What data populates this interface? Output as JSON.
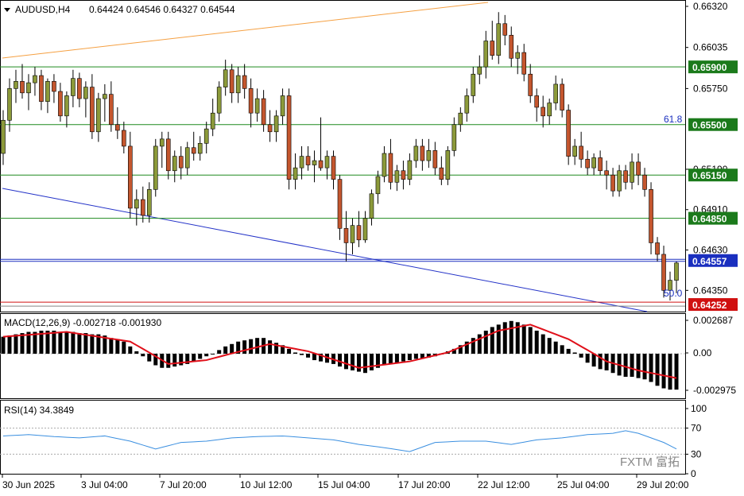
{
  "colors": {
    "bull": "#8c9a3a",
    "bear": "#c4562e",
    "wick": "#000000",
    "level": "#1f8a1f",
    "level_label_bg": "#1b7a1b",
    "current": "#1a2fbf",
    "red_level": "#d01010",
    "macd_signal": "#e0101a",
    "rsi_line": "#3a8fe0",
    "trend_orange": "#f5a042",
    "trend_blue": "#2433c8"
  },
  "header": {
    "symbol": "AUDUSD,H4",
    "ohlc": "0.64424 0.64546 0.64327 0.64544"
  },
  "price_axis": {
    "ticks": [
      "0.66320",
      "0.66035",
      "0.65750",
      "0.65190",
      "0.64910",
      "0.64630",
      "0.64350"
    ],
    "levels": [
      "0.65900",
      "0.65500",
      "0.65150",
      "0.64850"
    ],
    "current": "0.64557",
    "red_level": "0.64252"
  },
  "fib_labels": {
    "upper": "61.8",
    "lower": "50.0"
  },
  "macd": {
    "label": "MACD(12,26,9) -0.002718 -0.001930",
    "ticks": [
      "0.002687",
      "0.00",
      "-0.002975"
    ]
  },
  "rsi": {
    "label": "RSI(14) 34.3849",
    "ticks": [
      "100",
      "70",
      "30",
      "0"
    ]
  },
  "time_axis": [
    "30 Jun 2025",
    "3 Jul 04:00",
    "7 Jul 20:00",
    "10 Jul 12:00",
    "15 Jul 04:00",
    "17 Jul 20:00",
    "22 Jul 12:00",
    "25 Jul 04:00",
    "29 Jul 20:00"
  ],
  "watermark": "FXTM 富拓",
  "chart_data": {
    "type": "candlestick",
    "symbol": "AUDUSD",
    "timeframe": "H4",
    "ylim": [
      0.6419,
      0.6634
    ],
    "candles": [
      [
        0.653,
        0.656,
        0.6522,
        0.6553
      ],
      [
        0.6553,
        0.6582,
        0.6545,
        0.6575
      ],
      [
        0.6575,
        0.6588,
        0.6565,
        0.658
      ],
      [
        0.658,
        0.6592,
        0.6568,
        0.6572
      ],
      [
        0.6572,
        0.6585,
        0.656,
        0.6579
      ],
      [
        0.6579,
        0.659,
        0.657,
        0.6584
      ],
      [
        0.6584,
        0.6588,
        0.656,
        0.6566
      ],
      [
        0.6566,
        0.6582,
        0.6558,
        0.658
      ],
      [
        0.658,
        0.6585,
        0.6565,
        0.6573
      ],
      [
        0.6573,
        0.6579,
        0.6552,
        0.6556
      ],
      [
        0.6556,
        0.6573,
        0.6548,
        0.657
      ],
      [
        0.657,
        0.6588,
        0.6562,
        0.6582
      ],
      [
        0.6582,
        0.6586,
        0.6562,
        0.6568
      ],
      [
        0.6568,
        0.658,
        0.6555,
        0.6576
      ],
      [
        0.6576,
        0.6585,
        0.654,
        0.6545
      ],
      [
        0.6545,
        0.6572,
        0.6538,
        0.6568
      ],
      [
        0.6568,
        0.6578,
        0.6552,
        0.6571
      ],
      [
        0.6571,
        0.658,
        0.6545,
        0.655
      ],
      [
        0.655,
        0.6562,
        0.654,
        0.6546
      ],
      [
        0.6546,
        0.6552,
        0.653,
        0.6535
      ],
      [
        0.6535,
        0.6545,
        0.6485,
        0.6492
      ],
      [
        0.6492,
        0.6505,
        0.648,
        0.6498
      ],
      [
        0.6498,
        0.6507,
        0.6482,
        0.6487
      ],
      [
        0.6487,
        0.651,
        0.6482,
        0.6505
      ],
      [
        0.6505,
        0.654,
        0.65,
        0.6535
      ],
      [
        0.6535,
        0.6545,
        0.652,
        0.654
      ],
      [
        0.654,
        0.6545,
        0.6512,
        0.6518
      ],
      [
        0.6518,
        0.6532,
        0.651,
        0.6528
      ],
      [
        0.6528,
        0.6535,
        0.6512,
        0.652
      ],
      [
        0.652,
        0.6538,
        0.6515,
        0.6534
      ],
      [
        0.6534,
        0.6545,
        0.6525,
        0.653
      ],
      [
        0.653,
        0.6542,
        0.6525,
        0.6537
      ],
      [
        0.6537,
        0.6552,
        0.653,
        0.6547
      ],
      [
        0.6547,
        0.6568,
        0.6542,
        0.6558
      ],
      [
        0.6558,
        0.658,
        0.6552,
        0.6576
      ],
      [
        0.6576,
        0.6595,
        0.657,
        0.6588
      ],
      [
        0.6588,
        0.6592,
        0.6565,
        0.6572
      ],
      [
        0.6572,
        0.659,
        0.6565,
        0.6584
      ],
      [
        0.6584,
        0.6592,
        0.6568,
        0.6575
      ],
      [
        0.6575,
        0.6582,
        0.6548,
        0.6558
      ],
      [
        0.6558,
        0.6575,
        0.6552,
        0.6568
      ],
      [
        0.6568,
        0.6574,
        0.6545,
        0.655
      ],
      [
        0.655,
        0.656,
        0.6538,
        0.6545
      ],
      [
        0.6545,
        0.656,
        0.6538,
        0.6556
      ],
      [
        0.6556,
        0.6575,
        0.655,
        0.657
      ],
      [
        0.657,
        0.6575,
        0.6505,
        0.6512
      ],
      [
        0.6512,
        0.653,
        0.6505,
        0.652
      ],
      [
        0.652,
        0.6535,
        0.6512,
        0.6528
      ],
      [
        0.6528,
        0.6535,
        0.6518,
        0.6522
      ],
      [
        0.6522,
        0.6532,
        0.651,
        0.6525
      ],
      [
        0.6525,
        0.6555,
        0.6518,
        0.652
      ],
      [
        0.652,
        0.6532,
        0.6512,
        0.6528
      ],
      [
        0.6528,
        0.6532,
        0.6505,
        0.6512
      ],
      [
        0.6512,
        0.6515,
        0.647,
        0.6478
      ],
      [
        0.6478,
        0.649,
        0.6455,
        0.6468
      ],
      [
        0.6468,
        0.6485,
        0.646,
        0.648
      ],
      [
        0.648,
        0.649,
        0.6465,
        0.647
      ],
      [
        0.647,
        0.649,
        0.6468,
        0.6485
      ],
      [
        0.6485,
        0.6505,
        0.648,
        0.6502
      ],
      [
        0.6502,
        0.6518,
        0.6495,
        0.6514
      ],
      [
        0.6514,
        0.6535,
        0.651,
        0.653
      ],
      [
        0.653,
        0.654,
        0.6505,
        0.651
      ],
      [
        0.651,
        0.6522,
        0.6504,
        0.6518
      ],
      [
        0.6518,
        0.6525,
        0.6505,
        0.6512
      ],
      [
        0.6512,
        0.653,
        0.6508,
        0.6525
      ],
      [
        0.6525,
        0.654,
        0.652,
        0.6535
      ],
      [
        0.6535,
        0.654,
        0.6518,
        0.6525
      ],
      [
        0.6525,
        0.654,
        0.652,
        0.6532
      ],
      [
        0.6532,
        0.6538,
        0.6515,
        0.652
      ],
      [
        0.652,
        0.6528,
        0.6508,
        0.6512
      ],
      [
        0.6512,
        0.6535,
        0.6508,
        0.6532
      ],
      [
        0.6532,
        0.6555,
        0.6528,
        0.655
      ],
      [
        0.655,
        0.6562,
        0.6545,
        0.6558
      ],
      [
        0.6558,
        0.6575,
        0.6552,
        0.657
      ],
      [
        0.657,
        0.659,
        0.6565,
        0.6585
      ],
      [
        0.6585,
        0.6598,
        0.6578,
        0.659
      ],
      [
        0.659,
        0.6615,
        0.6582,
        0.6608
      ],
      [
        0.6608,
        0.6622,
        0.6595,
        0.6598
      ],
      [
        0.6598,
        0.6628,
        0.6592,
        0.662
      ],
      [
        0.662,
        0.6626,
        0.6605,
        0.6612
      ],
      [
        0.6612,
        0.6618,
        0.659,
        0.6596
      ],
      [
        0.6596,
        0.6605,
        0.6585,
        0.66
      ],
      [
        0.66,
        0.6606,
        0.658,
        0.6585
      ],
      [
        0.6585,
        0.6592,
        0.6565,
        0.657
      ],
      [
        0.657,
        0.6575,
        0.6552,
        0.6562
      ],
      [
        0.6562,
        0.657,
        0.6548,
        0.6556
      ],
      [
        0.6556,
        0.6568,
        0.655,
        0.6565
      ],
      [
        0.6565,
        0.6584,
        0.656,
        0.6578
      ],
      [
        0.6578,
        0.6582,
        0.6555,
        0.656
      ],
      [
        0.656,
        0.6564,
        0.6522,
        0.6528
      ],
      [
        0.6528,
        0.654,
        0.6522,
        0.6535
      ],
      [
        0.6535,
        0.6545,
        0.652,
        0.6526
      ],
      [
        0.6526,
        0.6532,
        0.6515,
        0.652
      ],
      [
        0.652,
        0.653,
        0.6515,
        0.6527
      ],
      [
        0.6527,
        0.6532,
        0.6515,
        0.6518
      ],
      [
        0.6518,
        0.6525,
        0.6505,
        0.6515
      ],
      [
        0.6515,
        0.652,
        0.65,
        0.6504
      ],
      [
        0.6504,
        0.6522,
        0.65,
        0.6518
      ],
      [
        0.6518,
        0.6522,
        0.6505,
        0.651
      ],
      [
        0.651,
        0.653,
        0.6505,
        0.6524
      ],
      [
        0.6524,
        0.653,
        0.6508,
        0.6515
      ],
      [
        0.6515,
        0.652,
        0.65,
        0.6505
      ],
      [
        0.6505,
        0.651,
        0.646,
        0.6468
      ],
      [
        0.6468,
        0.6472,
        0.6455,
        0.646
      ],
      [
        0.646,
        0.6466,
        0.643,
        0.6435
      ],
      [
        0.6435,
        0.6448,
        0.6428,
        0.6442
      ],
      [
        0.6442,
        0.6455,
        0.6433,
        0.6454
      ]
    ],
    "macd_histogram": [
      0.0014,
      0.0015,
      0.0016,
      0.0017,
      0.0018,
      0.0018,
      0.0019,
      0.0019,
      0.0019,
      0.0018,
      0.0018,
      0.0018,
      0.0017,
      0.0017,
      0.0016,
      0.0016,
      0.0015,
      0.0013,
      0.0012,
      0.001,
      0.0006,
      0.0002,
      -0.0002,
      -0.0006,
      -0.0009,
      -0.0011,
      -0.0011,
      -0.001,
      -0.0009,
      -0.0008,
      -0.0006,
      -0.0004,
      -0.0002,
      0.0,
      0.0003,
      0.0006,
      0.0008,
      0.001,
      0.0011,
      0.0012,
      0.0013,
      0.0013,
      0.0011,
      0.0009,
      0.0007,
      0.0004,
      0.0001,
      -0.0001,
      -0.0003,
      -0.0005,
      -0.0006,
      -0.0007,
      -0.0008,
      -0.001,
      -0.0012,
      -0.0013,
      -0.0014,
      -0.0015,
      -0.0013,
      -0.0011,
      -0.0009,
      -0.0008,
      -0.0007,
      -0.0006,
      -0.0005,
      -0.0004,
      -0.0004,
      -0.0003,
      -0.0002,
      0.0,
      0.0002,
      0.0004,
      0.0007,
      0.001,
      0.0013,
      0.0016,
      0.0019,
      0.0022,
      0.0024,
      0.0026,
      0.0027,
      0.0026,
      0.0024,
      0.0022,
      0.0019,
      0.0016,
      0.0013,
      0.001,
      0.0007,
      0.0004,
      0.0001,
      -0.0003,
      -0.0007,
      -0.001,
      -0.0012,
      -0.0013,
      -0.0015,
      -0.0017,
      -0.0018,
      -0.0018,
      -0.0019,
      -0.002,
      -0.0022,
      -0.0025,
      -0.0027,
      -0.0028,
      -0.0028
    ],
    "macd_signal_anchors": [
      [
        0,
        0.0014
      ],
      [
        10,
        0.0018
      ],
      [
        20,
        0.001
      ],
      [
        26,
        -0.0008
      ],
      [
        32,
        -0.0005
      ],
      [
        42,
        0.0008
      ],
      [
        48,
        0.0002
      ],
      [
        56,
        -0.0011
      ],
      [
        64,
        -0.0006
      ],
      [
        70,
        0.0001
      ],
      [
        78,
        0.0019
      ],
      [
        83,
        0.0024
      ],
      [
        89,
        0.0012
      ],
      [
        95,
        -0.0006
      ],
      [
        100,
        -0.0013
      ],
      [
        106,
        -0.0019
      ]
    ],
    "rsi_anchors": [
      [
        0,
        58
      ],
      [
        4,
        60
      ],
      [
        8,
        57
      ],
      [
        12,
        55
      ],
      [
        16,
        58
      ],
      [
        20,
        50
      ],
      [
        24,
        38
      ],
      [
        28,
        48
      ],
      [
        32,
        50
      ],
      [
        36,
        55
      ],
      [
        40,
        57
      ],
      [
        44,
        58
      ],
      [
        48,
        55
      ],
      [
        52,
        52
      ],
      [
        56,
        45
      ],
      [
        60,
        40
      ],
      [
        64,
        34
      ],
      [
        68,
        48
      ],
      [
        72,
        50
      ],
      [
        76,
        50
      ],
      [
        80,
        45
      ],
      [
        84,
        52
      ],
      [
        88,
        55
      ],
      [
        92,
        60
      ],
      [
        96,
        62
      ],
      [
        98,
        66
      ],
      [
        100,
        62
      ],
      [
        102,
        55
      ],
      [
        104,
        48
      ],
      [
        106,
        38
      ],
      [
        108,
        38
      ],
      [
        110,
        40
      ],
      [
        112,
        35
      ],
      [
        114,
        38
      ],
      [
        116,
        30
      ],
      [
        118,
        34
      ]
    ]
  }
}
